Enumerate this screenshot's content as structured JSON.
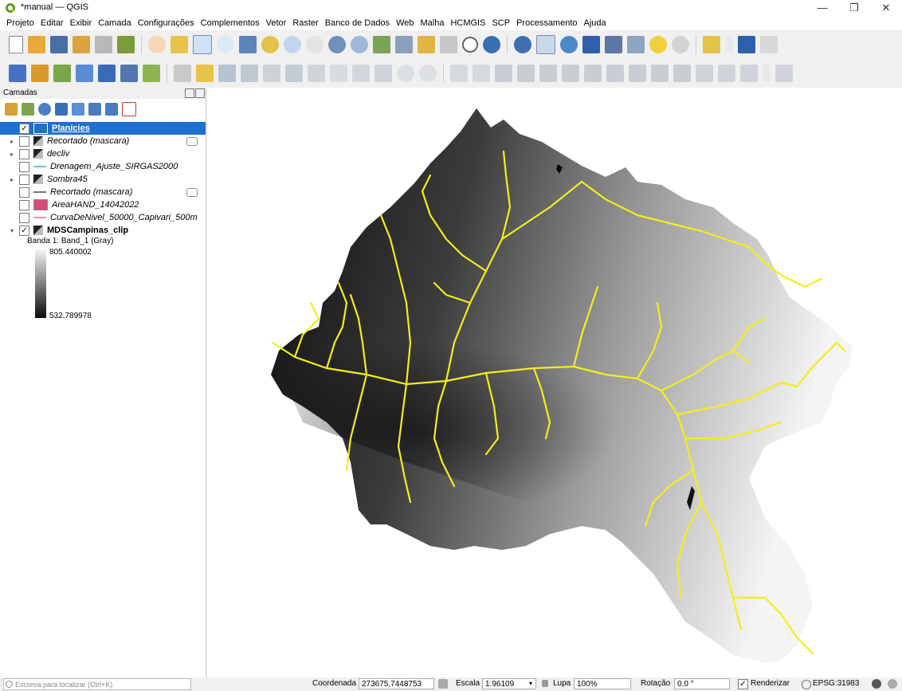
{
  "window": {
    "title": "*manual — QGIS",
    "minimize": "—",
    "maximize": "❐",
    "close": "✕"
  },
  "menubar": [
    "Projeto",
    "Editar",
    "Exibir",
    "Camada",
    "Configurações",
    "Complementos",
    "Vetor",
    "Raster",
    "Banco de Dados",
    "Web",
    "Malha",
    "HCMGIS",
    "SCP",
    "Processamento",
    "Ajuda"
  ],
  "layers_panel": {
    "title": "Camadas",
    "layers": [
      {
        "name": "Planícies",
        "checked": true,
        "style": "link",
        "expander": "",
        "symbol": "fill-blue",
        "selected": true
      },
      {
        "name": "Recortado (mascara)",
        "checked": false,
        "style": "italic",
        "expander": "▸",
        "symbol": "raster",
        "has_indicator": true
      },
      {
        "name": "decliv",
        "checked": false,
        "style": "italic",
        "expander": "▸",
        "symbol": "raster"
      },
      {
        "name": "Drenagem_Ajuste_SIRGAS2000",
        "checked": false,
        "style": "italic",
        "expander": "",
        "symbol": "line-cyan"
      },
      {
        "name": "Sombra45",
        "checked": false,
        "style": "italic",
        "expander": "▸",
        "symbol": "raster"
      },
      {
        "name": "Recortado (mascara)",
        "checked": false,
        "style": "italic",
        "expander": "",
        "symbol": "line-gray",
        "has_indicator": true
      },
      {
        "name": "AreaHAND_14042022",
        "checked": false,
        "style": "italic",
        "expander": "",
        "symbol": "fill-pink"
      },
      {
        "name": "CurvaDeNivel_50000_Capivari_500m",
        "checked": false,
        "style": "italic",
        "expander": "",
        "symbol": "line-pink"
      },
      {
        "name": "MDSCampinas_clip",
        "checked": true,
        "style": "bold",
        "expander": "▾",
        "symbol": "raster"
      }
    ],
    "legend": {
      "band": "Banda 1: Band_1 (Gray)",
      "max": "805.440002",
      "min": "532.789978"
    }
  },
  "colors": {
    "drainage": "#f2ee1c",
    "selection": "#1f6fcf",
    "dem_low": "#0a0a0a",
    "dem_high": "#f4f4f4"
  },
  "statusbar": {
    "locator_placeholder": "Escreva para localizar (Ctrl+K)",
    "coord_label": "Coordenada",
    "coord_value": "273675,7448753",
    "scale_label": "Escala",
    "scale_value": "1:96109",
    "magnifier_label": "Lupa",
    "magnifier_value": "100%",
    "rotation_label": "Rotação",
    "rotation_value": "0.0 °",
    "render_label": "Renderizar",
    "crs": "EPSG:31983"
  }
}
